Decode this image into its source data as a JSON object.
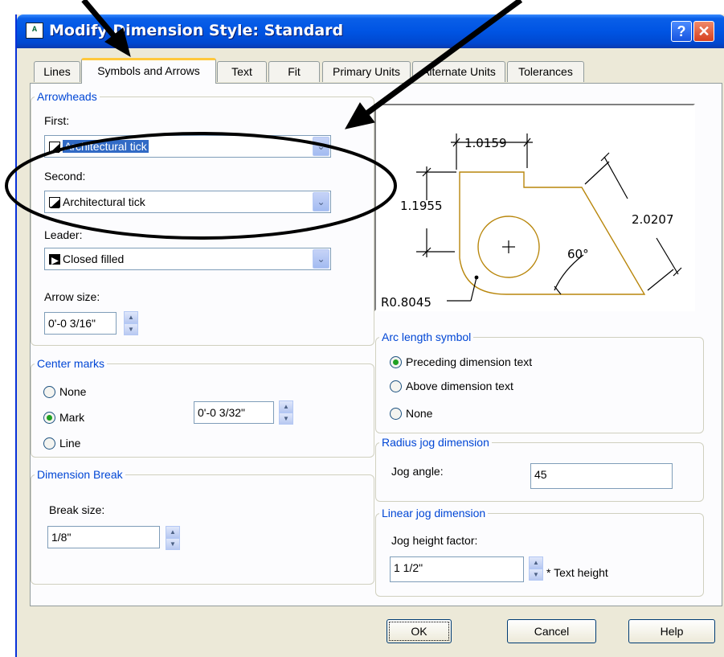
{
  "window": {
    "title": "Modify Dimension Style: Standard",
    "help_glyph": "?",
    "close_glyph": "✕"
  },
  "tabs": [
    {
      "label": "Lines"
    },
    {
      "label": "Symbols and Arrows"
    },
    {
      "label": "Text"
    },
    {
      "label": "Fit"
    },
    {
      "label": "Primary Units"
    },
    {
      "label": "Alternate Units"
    },
    {
      "label": "Tolerances"
    }
  ],
  "arrowheads": {
    "legend": "Arrowheads",
    "first_label": "First:",
    "first_value": "Architectural tick",
    "second_label": "Second:",
    "second_value": "Architectural tick",
    "leader_label": "Leader:",
    "leader_value": "Closed filled",
    "arrow_size_label": "Arrow size:",
    "arrow_size_value": "0'-0 3/16\""
  },
  "center_marks": {
    "legend": "Center marks",
    "options": [
      "None",
      "Mark",
      "Line"
    ],
    "selected": "Mark",
    "size_value": "0'-0 3/32\""
  },
  "dimension_break": {
    "legend": "Dimension Break",
    "break_size_label": "Break size:",
    "break_size_value": "1/8\""
  },
  "preview": {
    "dim_top": "1.0159",
    "dim_left": "1.1955",
    "dim_right": "2.0207",
    "angle": "60°",
    "radius": "R0.8045",
    "center_mark": "+"
  },
  "arc_length": {
    "legend": "Arc length symbol",
    "options": [
      "Preceding dimension text",
      "Above dimension text",
      "None"
    ],
    "selected": "Preceding dimension text"
  },
  "radius_jog": {
    "legend": "Radius jog dimension",
    "jog_angle_label": "Jog angle:",
    "jog_angle_value": "45"
  },
  "linear_jog": {
    "legend": "Linear jog dimension",
    "factor_label": "Jog height factor:",
    "factor_value": "1 1/2\"",
    "suffix": "* Text height"
  },
  "buttons": {
    "ok": "OK",
    "cancel": "Cancel",
    "help": "Help"
  },
  "colors": {
    "titlebar": "#0054e3",
    "legend": "#0046d5",
    "preview_geometry": "#b8860b",
    "selection": "#316ac5"
  },
  "icons": {
    "app": "autocad-icon",
    "spin_up": "▲",
    "spin_down": "▼",
    "dropdown": "⌄"
  }
}
